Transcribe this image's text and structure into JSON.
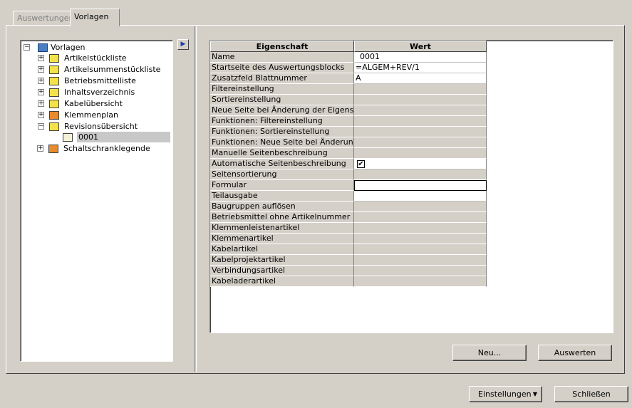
{
  "tabs": [
    {
      "label": "Auswertungen"
    },
    {
      "label": "Vorlagen"
    }
  ],
  "tree": {
    "root": "Vorlagen",
    "items": [
      {
        "label": "Artikelstückliste",
        "icon": "yellow-folder-icon"
      },
      {
        "label": "Artikelsummenstückliste",
        "icon": "yellow-folder-icon"
      },
      {
        "label": "Betriebsmittelliste",
        "icon": "yellow-folder-icon"
      },
      {
        "label": "Inhaltsverzeichnis",
        "icon": "yellow-folder-icon"
      },
      {
        "label": "Kabelübersicht",
        "icon": "yellow-folder-icon"
      },
      {
        "label": "Klemmenplan",
        "icon": "orange-folder-icon"
      },
      {
        "label": "Revisionsübersicht",
        "icon": "yellow-folder-icon"
      },
      {
        "label": "0001",
        "icon": "printer-icon"
      },
      {
        "label": "Schaltschranklegende",
        "icon": "orange-folder-icon"
      }
    ]
  },
  "grid": {
    "header_property": "Eigenschaft",
    "header_value": "Wert",
    "rows": [
      {
        "name": "Name",
        "value": "0001"
      },
      {
        "name": "Startseite des Auswertungsblocks",
        "value": "=ALGEM+REV/1"
      },
      {
        "name": "Zusatzfeld Blattnummer",
        "value": "A"
      },
      {
        "name": "Filtereinstellung",
        "value": ""
      },
      {
        "name": "Sortiereinstellung",
        "value": ""
      },
      {
        "name": "Neue Seite bei Änderung der Eigenschaft",
        "value": ""
      },
      {
        "name": "Funktionen: Filtereinstellung",
        "value": ""
      },
      {
        "name": "Funktionen: Sortiereinstellung",
        "value": ""
      },
      {
        "name": "Funktionen: Neue Seite bei Änderung ...",
        "value": ""
      },
      {
        "name": "Manuelle Seitenbeschreibung",
        "value": ""
      },
      {
        "name": "Automatische Seitenbeschreibung",
        "value": "✔"
      },
      {
        "name": "Seitensortierung",
        "value": ""
      },
      {
        "name": "Formular",
        "value": ""
      },
      {
        "name": "Teilausgabe",
        "value": ""
      },
      {
        "name": "Baugruppen auflösen",
        "value": ""
      },
      {
        "name": "Betriebsmittel ohne Artikelnummer",
        "value": ""
      },
      {
        "name": "Klemmenleistenartikel",
        "value": ""
      },
      {
        "name": "Klemmenartikel",
        "value": ""
      },
      {
        "name": "Kabelartikel",
        "value": ""
      },
      {
        "name": "Kabelprojektartikel",
        "value": ""
      },
      {
        "name": "Verbindungsartikel",
        "value": ""
      },
      {
        "name": "Kabeladerartikel",
        "value": ""
      }
    ]
  },
  "buttons": {
    "neu": "Neu...",
    "auswerten": "Auswerten",
    "einstellungen": "Einstellungen",
    "schliessen": "Schließen"
  },
  "colors": {
    "dialog_bg": "#d4d0c8",
    "tree_icon_yellow": "#f3e24a",
    "tree_icon_orange": "#e98a2c"
  }
}
